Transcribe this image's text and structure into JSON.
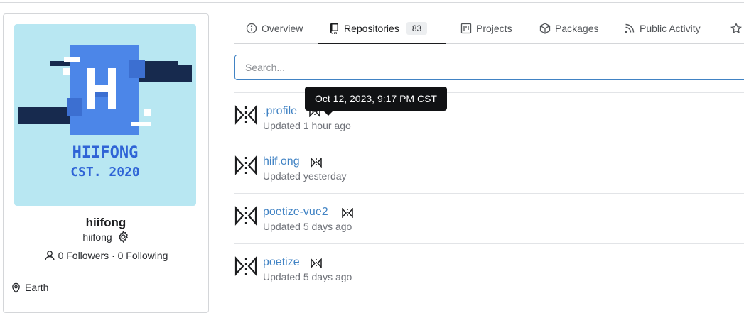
{
  "profile": {
    "avatar_line1": "HIIFONG",
    "avatar_line2": "CST. 2020",
    "name": "hiifong",
    "login": "hiifong",
    "followers": "0 Followers",
    "following": "0 Following",
    "separator": "·",
    "location": "Earth"
  },
  "tabs": [
    {
      "label": "Overview",
      "icon": "info-icon"
    },
    {
      "label": "Repositories",
      "icon": "repo-icon",
      "count": "83",
      "active": true
    },
    {
      "label": "Projects",
      "icon": "project-icon"
    },
    {
      "label": "Packages",
      "icon": "package-icon"
    },
    {
      "label": "Public Activity",
      "icon": "rss-icon"
    },
    {
      "label": "",
      "icon": "star-icon"
    }
  ],
  "search": {
    "placeholder": "Search..."
  },
  "repos": [
    {
      "name": ".profile",
      "updated": "Updated 1 hour ago"
    },
    {
      "name": "hiif.ong",
      "updated": "Updated yesterday"
    },
    {
      "name": "poetize-vue2",
      "updated": "Updated 5 days ago"
    },
    {
      "name": "poetize",
      "updated": "Updated 5 days ago"
    }
  ],
  "tooltip": {
    "text": "Oct 12, 2023, 9:17 PM CST"
  },
  "colors": {
    "link": "#4183c4",
    "avatar_bg": "#b8e7f2",
    "avatar_blue": "#4c86e8",
    "avatar_navy": "#172a4e"
  }
}
